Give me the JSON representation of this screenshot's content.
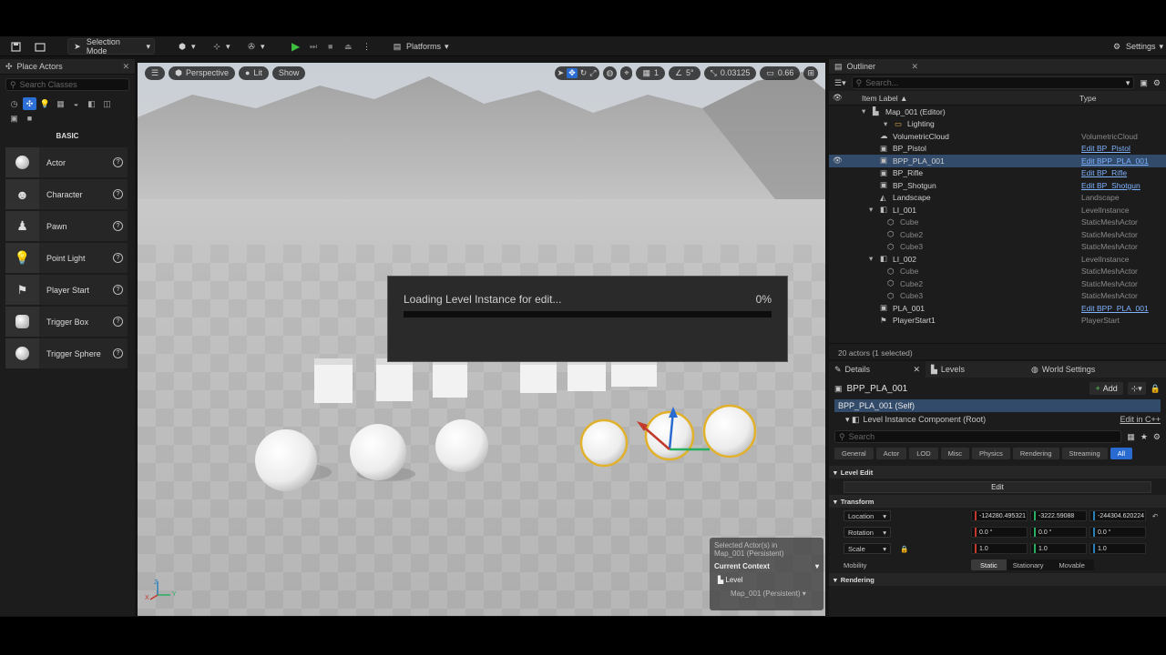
{
  "toolbar": {
    "selection_mode": "Selection Mode",
    "platforms": "Platforms",
    "settings": "Settings"
  },
  "place_actors": {
    "tab_label": "Place Actors",
    "search_placeholder": "Search Classes",
    "section": "BASIC",
    "items": [
      "Actor",
      "Character",
      "Pawn",
      "Point Light",
      "Player Start",
      "Trigger Box",
      "Trigger Sphere"
    ]
  },
  "viewport": {
    "perspective": "Perspective",
    "lit": "Lit",
    "show": "Show",
    "grid_snap": "1",
    "rot_snap": "5°",
    "scale_snap": "0.03125",
    "camera_speed": "0.66",
    "loading": {
      "label": "Loading Level Instance for edit...",
      "percent_text": "0%",
      "progress": 0.0
    },
    "context": {
      "selected": "Selected Actor(s) in",
      "selected_map": "Map_001 (Persistent)",
      "current_context": "Current Context",
      "level": "Level",
      "level_value": "Map_001 (Persistent)"
    },
    "axis_z": "Z",
    "axis_x": "X",
    "axis_y": "Y"
  },
  "outliner": {
    "tab_label": "Outliner",
    "search_placeholder": "Search...",
    "col_label": "Item Label ▲",
    "col_type": "Type",
    "rows": [
      {
        "name": "Map_001 (Editor)",
        "type": ""
      },
      {
        "name": "Lighting",
        "type": ""
      },
      {
        "name": "VolumetricCloud",
        "type": "VolumetricCloud"
      },
      {
        "name": "BP_Pistol",
        "type": "Edit BP_Pistol"
      },
      {
        "name": "BPP_PLA_001",
        "type": "Edit BPP_PLA_001"
      },
      {
        "name": "BP_Rifle",
        "type": "Edit BP_Rifle"
      },
      {
        "name": "BP_Shotgun",
        "type": "Edit BP_Shotgun"
      },
      {
        "name": "Landscape",
        "type": "Landscape"
      },
      {
        "name": "LI_001",
        "type": "LevelInstance"
      },
      {
        "name": "Cube",
        "type": "StaticMeshActor"
      },
      {
        "name": "Cube2",
        "type": "StaticMeshActor"
      },
      {
        "name": "Cube3",
        "type": "StaticMeshActor"
      },
      {
        "name": "LI_002",
        "type": "LevelInstance"
      },
      {
        "name": "Cube",
        "type": "StaticMeshActor"
      },
      {
        "name": "Cube2",
        "type": "StaticMeshActor"
      },
      {
        "name": "Cube3",
        "type": "StaticMeshActor"
      },
      {
        "name": "PLA_001",
        "type": "Edit BPP_PLA_001"
      },
      {
        "name": "PlayerStart1",
        "type": "PlayerStart"
      }
    ],
    "footer": "20 actors (1 selected)"
  },
  "details": {
    "tabs": [
      "Details",
      "Levels",
      "World Settings"
    ],
    "actor_name": "BPP_PLA_001",
    "add_label": "Add",
    "self_row": "BPP_PLA_001 (Self)",
    "component_row": "Level Instance Component (Root)",
    "edit_cpp": "Edit in C++",
    "search_placeholder": "Search",
    "filters": [
      "General",
      "Actor",
      "LOD",
      "Misc",
      "Physics",
      "Rendering",
      "Streaming",
      "All"
    ],
    "level_edit_section": "Level Edit",
    "edit_button": "Edit",
    "transform_section": "Transform",
    "location_label": "Location",
    "location": [
      "-124280.495321",
      "-3222.59088",
      "-244304.620224"
    ],
    "rotation_label": "Rotation",
    "rotation": [
      "0.0 °",
      "0.0 °",
      "0.0 °"
    ],
    "scale_label": "Scale",
    "scale": [
      "1.0",
      "1.0",
      "1.0"
    ],
    "mobility_label": "Mobility",
    "mobility_options": [
      "Static",
      "Stationary",
      "Movable"
    ],
    "rendering_section": "Rendering"
  },
  "colors": {
    "accent": "#2a6bd1",
    "selection": "#324b6b",
    "link": "#7fb3ff",
    "axis_x": "#c0392b",
    "axis_y": "#27ae60",
    "axis_z": "#2980b9"
  }
}
